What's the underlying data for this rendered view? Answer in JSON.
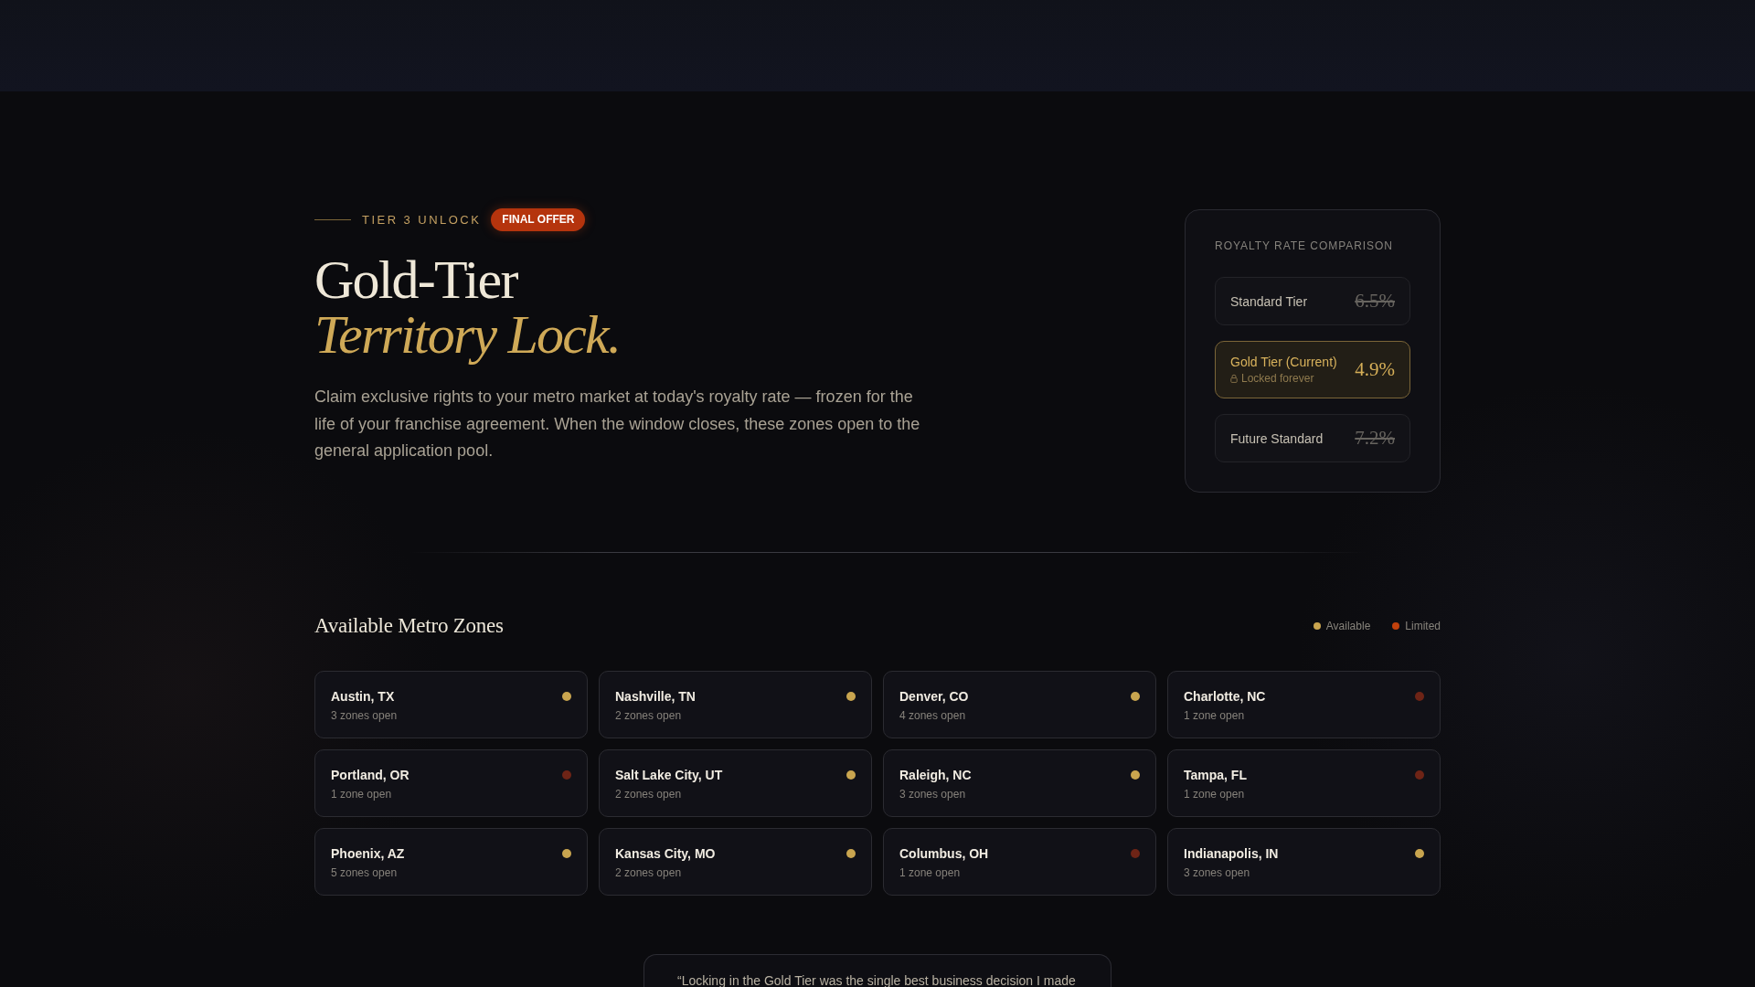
{
  "hero": {
    "eyebrow": "TIER 3 UNLOCK",
    "badge": "FINAL OFFER",
    "title": "Gold-Tier",
    "title_accent": "Territory Lock.",
    "description": "Claim exclusive rights to your metro market at today's royalty rate — frozen for the life of your franchise agreement. When the window closes, these zones open to the general application pool."
  },
  "rate_card": {
    "title": "ROYALTY RATE COMPARISON",
    "rows": [
      {
        "label": "Standard Tier",
        "value": "6.5%",
        "current": false
      },
      {
        "label": "Gold Tier (Current)",
        "note": "Locked forever",
        "value": "4.9%",
        "current": true
      },
      {
        "label": "Future Standard",
        "value": "7.2%",
        "current": false
      }
    ]
  },
  "zones": {
    "title": "Available Metro Zones",
    "legend": [
      {
        "label": "Available",
        "color": "#c9a54f"
      },
      {
        "label": "Limited",
        "color": "#c2410c"
      }
    ],
    "items": [
      {
        "name": "Austin, TX",
        "detail": "3 zones open",
        "color": "#c9a54f"
      },
      {
        "name": "Nashville, TN",
        "detail": "2 zones open",
        "color": "#c9a54f"
      },
      {
        "name": "Denver, CO",
        "detail": "4 zones open",
        "color": "#c9a54f"
      },
      {
        "name": "Charlotte, NC",
        "detail": "1 zone open",
        "color": "#6e2416"
      },
      {
        "name": "Portland, OR",
        "detail": "1 zone open",
        "color": "#6e2416"
      },
      {
        "name": "Salt Lake City, UT",
        "detail": "2 zones open",
        "color": "#c9a54f"
      },
      {
        "name": "Raleigh, NC",
        "detail": "3 zones open",
        "color": "#c9a54f"
      },
      {
        "name": "Tampa, FL",
        "detail": "1 zone open",
        "color": "#6e2416"
      },
      {
        "name": "Phoenix, AZ",
        "detail": "5 zones open",
        "color": "#c9a54f"
      },
      {
        "name": "Kansas City, MO",
        "detail": "2 zones open",
        "color": "#c9a54f"
      },
      {
        "name": "Columbus, OH",
        "detail": "1 zone open",
        "color": "#6e2416"
      },
      {
        "name": "Indianapolis, IN",
        "detail": "3 zones open",
        "color": "#c9a54f"
      }
    ]
  },
  "testimonial": {
    "quote": "“Locking in the Gold Tier was the single best business decision I made"
  }
}
